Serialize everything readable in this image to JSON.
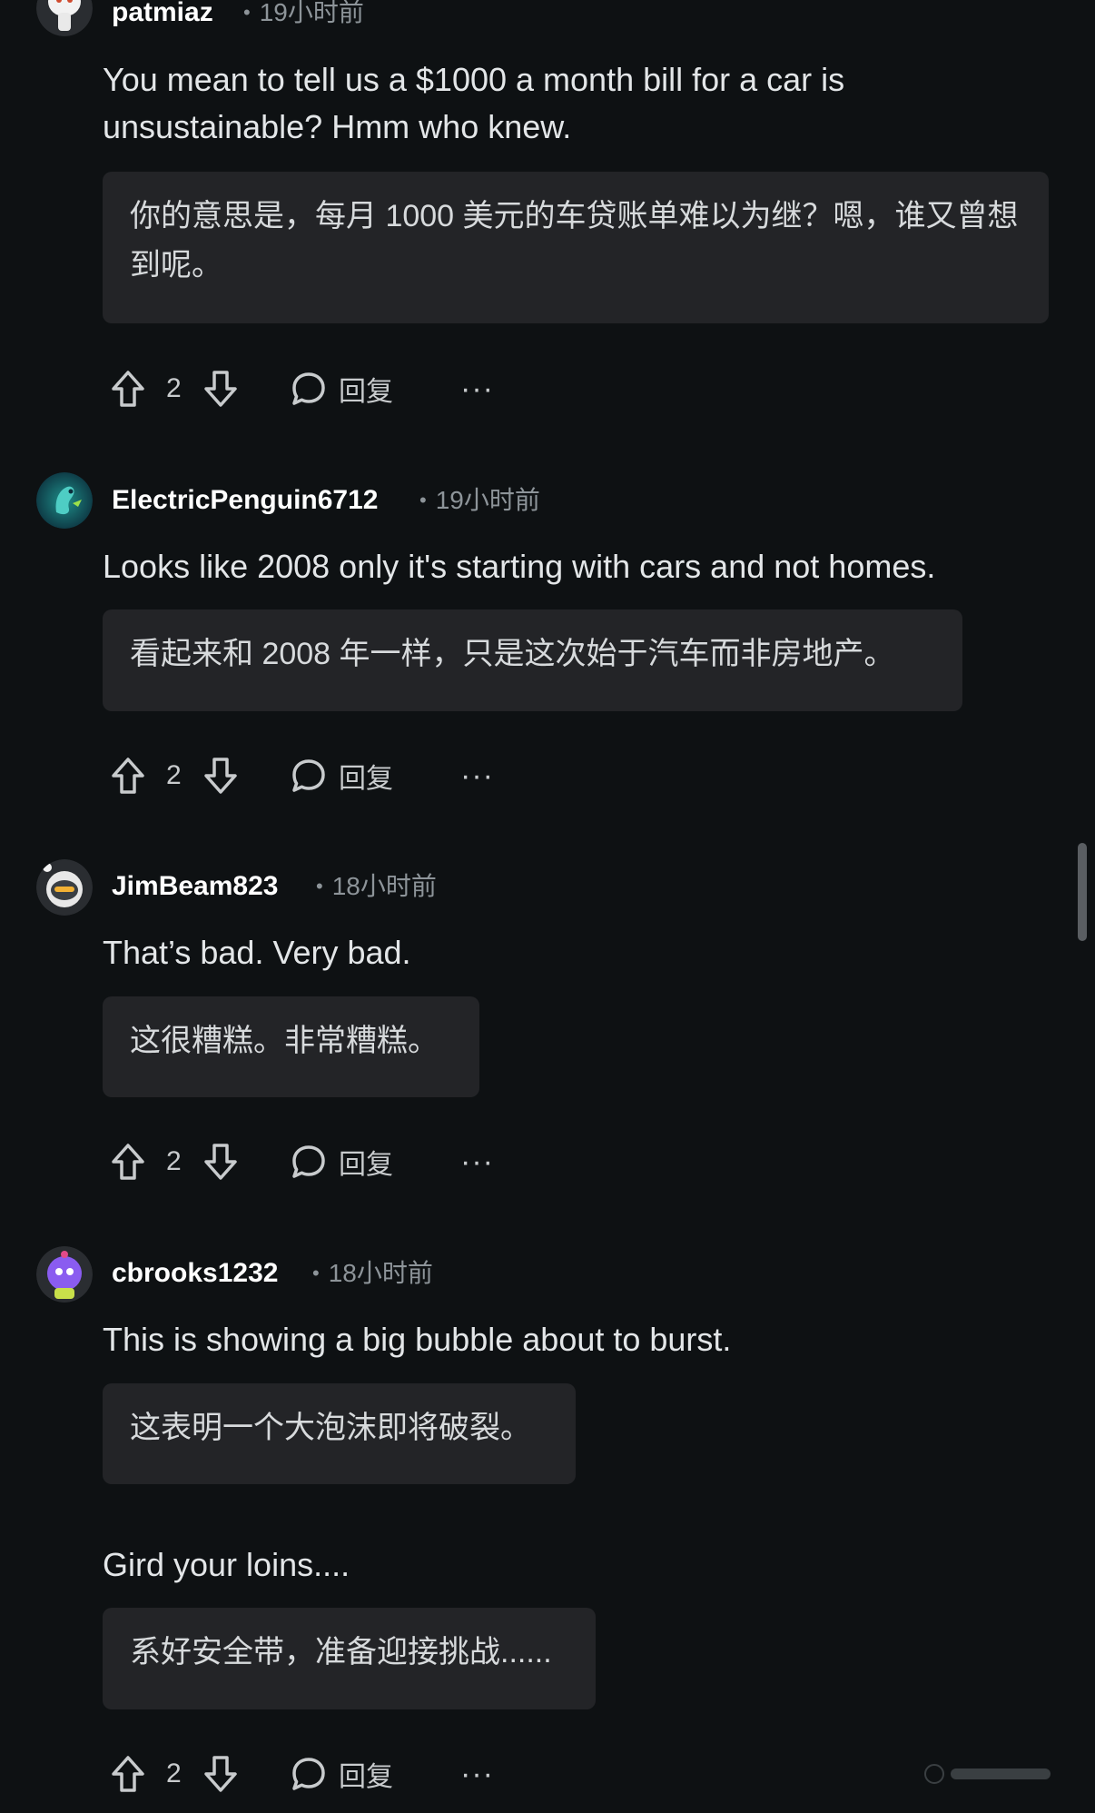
{
  "comments": [
    {
      "username": "patmiaz",
      "time": "19小时前",
      "text": "You mean to tell us a $1000 a month bill for a car is unsustainable? Hmm who knew.",
      "translation": "你的意思是，每月 1000 美元的车贷账单难以为继？嗯，谁又曾想到呢。",
      "votes": "2",
      "reply_label": "回复",
      "more": "···"
    },
    {
      "username": "ElectricPenguin6712",
      "time": "19小时前",
      "text": "Looks like 2008 only it's starting with cars and not homes.",
      "translation": "看起来和 2008 年一样，只是这次始于汽车而非房地产。",
      "votes": "2",
      "reply_label": "回复",
      "more": "···"
    },
    {
      "username": "JimBeam823",
      "time": "18小时前",
      "text": "That’s bad. Very bad.",
      "translation": "这很糟糕。非常糟糕。",
      "votes": "2",
      "reply_label": "回复",
      "more": "···"
    },
    {
      "username": "cbrooks1232",
      "time": "18小时前",
      "text": "This is showing a big bubble about to burst.",
      "translation": "这表明一个大泡沫即将破裂。",
      "text2": "Gird your loins....",
      "translation2": "系好安全带，准备迎接挑战......",
      "votes": "2",
      "reply_label": "回复",
      "more": "···"
    }
  ],
  "colors": {
    "background": "#0e1113",
    "translation_bg": "#232427",
    "meta_text": "#8d9499"
  },
  "icons": [
    "upvote-icon",
    "downvote-icon",
    "comment-bubble-icon",
    "more-options-icon"
  ]
}
